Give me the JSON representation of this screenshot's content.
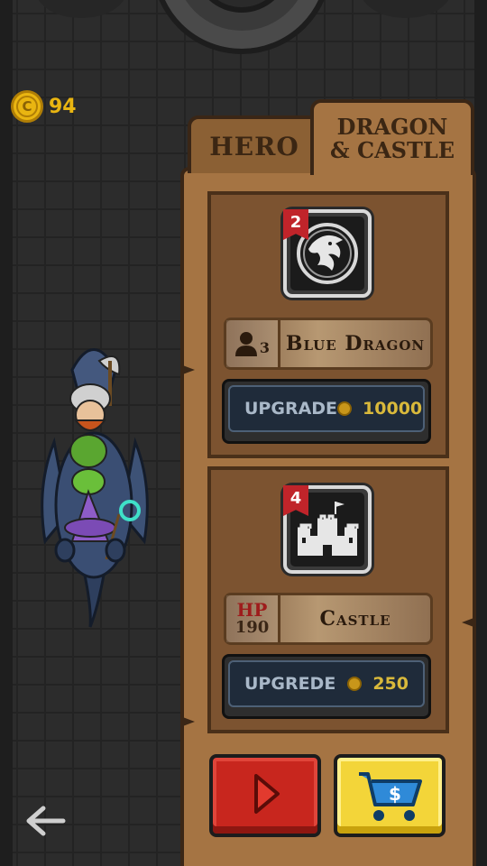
{
  "currency": {
    "coins": "94",
    "coin_symbol": "C"
  },
  "tabs": {
    "hero": "HERO",
    "dragon_castle_line1": "DRAGON",
    "dragon_castle_line2": "& CASTLE"
  },
  "dragon": {
    "level": "2",
    "rider_count": "3",
    "name": "Blue Dragon",
    "upgrade_label": "UPGRADE",
    "upgrade_cost": "10000",
    "icon": "dragon-emblem-icon"
  },
  "castle": {
    "level": "4",
    "hp_label": "HP",
    "hp_value": "190",
    "name": "Castle",
    "upgrade_label": "UPGREDE",
    "upgrade_cost": "250",
    "icon": "castle-icon"
  },
  "buttons": {
    "play_icon": "play-icon",
    "shop_icon": "shopping-cart-icon",
    "shop_symbol": "$",
    "back_icon": "back-arrow-icon"
  }
}
